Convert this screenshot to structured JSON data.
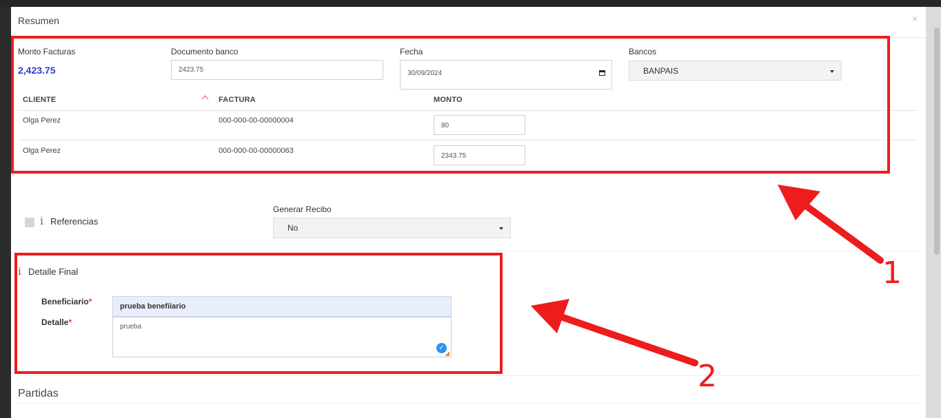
{
  "modal": {
    "title": "Resumen",
    "close_label": "×"
  },
  "summary": {
    "monto_label": "Monto Facturas",
    "monto_value": "2,423.75",
    "documento_label": "Documento banco",
    "documento_value": "2423.75",
    "fecha_label": "Fecha",
    "fecha_value": "30/09/2024",
    "bancos_label": "Bancos",
    "bancos_value": "BANPAIS"
  },
  "table": {
    "headers": [
      "CLIENTE",
      "FACTURA",
      "MONTO"
    ],
    "rows": [
      {
        "cliente": "Olga Perez",
        "factura": "000-000-00-00000004",
        "monto": "80"
      },
      {
        "cliente": "Olga Perez",
        "factura": "000-000-00-00000063",
        "monto": "2343.75"
      }
    ]
  },
  "options": {
    "referencias_label": "Referencias",
    "generar_recibo_label": "Generar Recibo",
    "generar_recibo_value": "No"
  },
  "detalle": {
    "title": "Detalle Final",
    "beneficiario_label": "Beneficiario",
    "beneficiario_value": "prueba benefiiario",
    "detalle_label": "Detalle",
    "detalle_value": "prueba",
    "required_mark": "*"
  },
  "partidas": {
    "title": "Partidas"
  },
  "annotations": {
    "label_1": "1",
    "label_2": "2",
    "color": "#ee1c1c"
  },
  "colors": {
    "amount": "#2f3fcf",
    "required": "#e53935",
    "sort_arrow": "#d9534f"
  }
}
